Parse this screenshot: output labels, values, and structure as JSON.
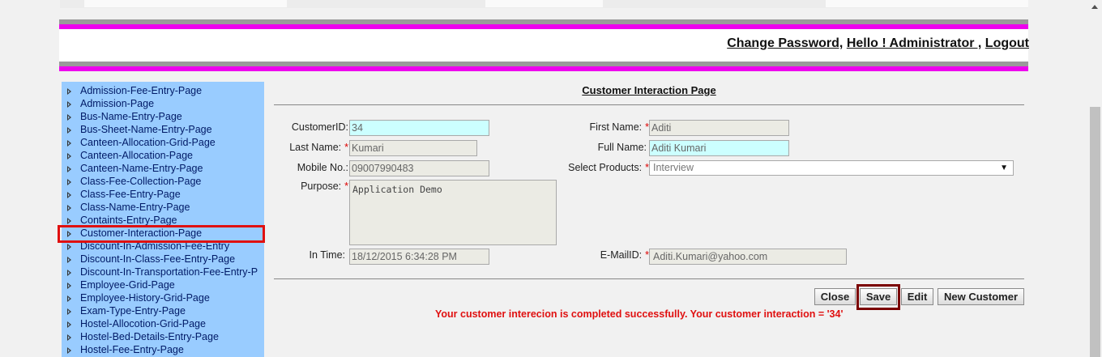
{
  "header": {
    "change_password": "Change Password,",
    "greeting": "Hello ! Administrator ,",
    "logout": "Logout"
  },
  "sidebar": {
    "items": [
      {
        "label": "Admission-Fee-Entry-Page"
      },
      {
        "label": "Admission-Page"
      },
      {
        "label": "Bus-Name-Entry-Page"
      },
      {
        "label": "Bus-Sheet-Name-Entry-Page"
      },
      {
        "label": "Canteen-Allocation-Grid-Page"
      },
      {
        "label": "Canteen-Allocation-Page"
      },
      {
        "label": "Canteen-Name-Entry-Page"
      },
      {
        "label": "Class-Fee-Collection-Page"
      },
      {
        "label": "Class-Fee-Entry-Page"
      },
      {
        "label": "Class-Name-Entry-Page"
      },
      {
        "label": "Containts-Entry-Page"
      },
      {
        "label": "Customer-Interaction-Page"
      },
      {
        "label": "Discount-In-Admission-Fee-Entry"
      },
      {
        "label": "Discount-In-Class-Fee-Entry-Page"
      },
      {
        "label": "Discount-In-Transportation-Fee-Entry-P"
      },
      {
        "label": "Employee-Grid-Page"
      },
      {
        "label": "Employee-History-Grid-Page"
      },
      {
        "label": "Exam-Type-Entry-Page"
      },
      {
        "label": "Hostel-Allocotion-Grid-Page"
      },
      {
        "label": "Hostel-Bed-Details-Entry-Page"
      },
      {
        "label": "Hostel-Fee-Entry-Page"
      }
    ],
    "selected": "Customer-Interaction-Page"
  },
  "form": {
    "title": "Customer Interaction Page",
    "customer_id": {
      "label": "CustomerID:",
      "value": "34"
    },
    "last_name": {
      "label": "Last Name:",
      "value": "Kumari"
    },
    "mobile": {
      "label": "Mobile No.:",
      "value": "09007990483"
    },
    "purpose": {
      "label": "Purpose:",
      "value": "Application Demo"
    },
    "in_time": {
      "label": "In Time:",
      "value": "18/12/2015 6:34:28 PM"
    },
    "first_name": {
      "label": "First Name:",
      "value": "Aditi"
    },
    "full_name": {
      "label": "Full Name:",
      "value": "Aditi Kumari"
    },
    "products": {
      "label": "Select Products:",
      "value": "Interview"
    },
    "email": {
      "label": "E-MailID:",
      "value": "Aditi.Kumari@yahoo.com"
    },
    "required_mark": "*"
  },
  "buttons": {
    "close": "Close",
    "save": "Save",
    "edit": "Edit",
    "new_customer": "New Customer"
  },
  "message": "Your customer interecion is completed successfully. Your customer interaction = '34'",
  "colors": {
    "sidebar_bg": "#99ccff",
    "accent_pink": "#ee00ee",
    "highlight_red": "#e01010",
    "message_red": "#e01010",
    "highlighted_input": "#ccffff"
  }
}
